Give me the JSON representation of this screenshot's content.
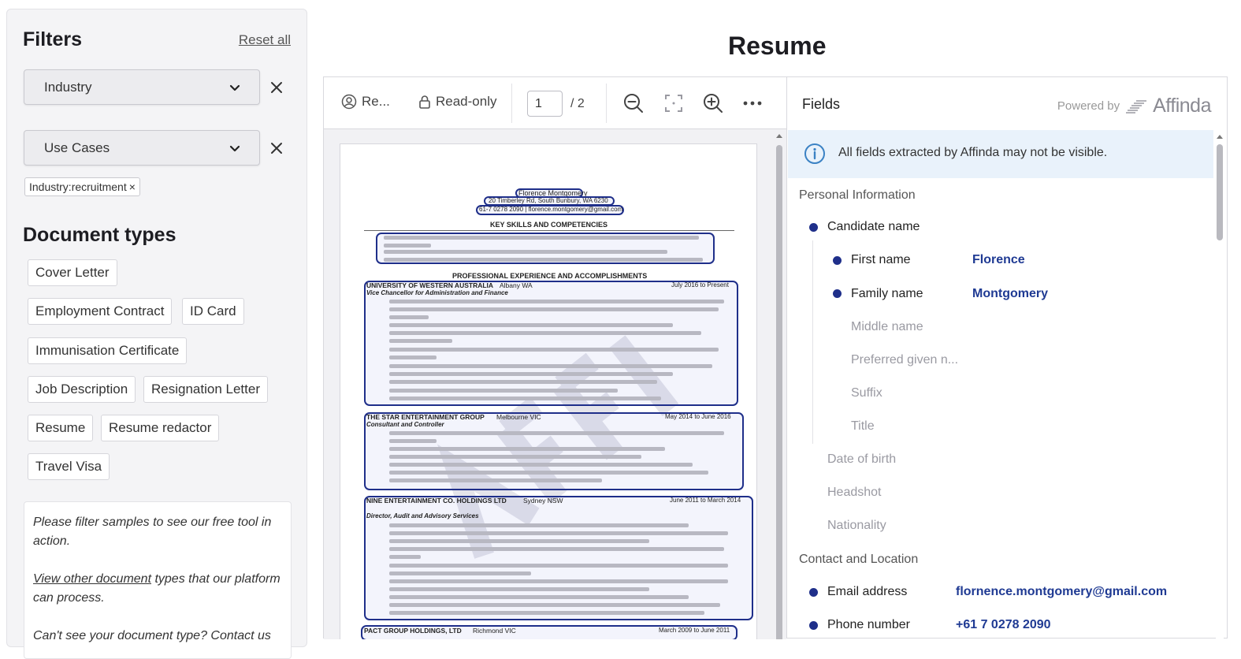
{
  "filters": {
    "title": "Filters",
    "reset_label": "Reset all",
    "selects": [
      {
        "label": "Industry"
      },
      {
        "label": "Use Cases"
      }
    ],
    "active_chip": "Industry:recruitment",
    "chip_close": "×"
  },
  "doc_types": {
    "title": "Document types",
    "items": [
      "Cover Letter",
      "Employment Contract",
      "ID Card",
      "Immunisation Certificate",
      "Job Description",
      "Resignation Letter",
      "Resume",
      "Resume redactor",
      "Travel Visa"
    ]
  },
  "info_box": {
    "line1": "Please filter samples to see our free tool in action.",
    "link": "View other document",
    "line2_rest": " types that our platform can process.",
    "line3": "Can't see your document type? Contact us"
  },
  "main": {
    "title": "Resume"
  },
  "toolbar": {
    "doc_label": "Re...",
    "readonly_label": "Read-only",
    "page_current": "1",
    "page_total": "/  2"
  },
  "resume_page": {
    "name": "Florence Montgomery",
    "address": "20 Timberley Rd, South Bunbury, WA 6230",
    "contact": "61-7 0278 2090 | florence.montgomery@gmail.com",
    "section1": "KEY SKILLS AND COMPETENCIES",
    "section2": "PROFESSIONAL EXPERIENCE AND ACCOMPLISHMENTS",
    "jobs": [
      {
        "org": "UNIVERSITY OF WESTERN AUSTRALIA",
        "loc": "Albany WA",
        "dates": "July 2016 to Present",
        "role": "Vice Chancellor for Administration and Finance"
      },
      {
        "org": "THE STAR ENTERTAINMENT GROUP",
        "loc": "Melbourne VIC",
        "dates": "May 2014 to June 2016",
        "role": "Consultant and Controller"
      },
      {
        "org": "NINE ENTERTAINMENT CO. HOLDINGS LTD",
        "loc": "Sydney NSW",
        "dates": "June 2011 to March 2014",
        "role": "Director, Audit and Advisory Services"
      },
      {
        "org": "PACT GROUP HOLDINGS, LTD",
        "loc": "Richmond VIC",
        "dates": "March 2009 to June 2011",
        "role": ""
      }
    ]
  },
  "fields": {
    "title": "Fields",
    "powered_by": "Powered by",
    "brand": "Affinda",
    "notice": "All fields extracted by Affinda may not be visible.",
    "sections": {
      "personal": "Personal Information",
      "contact": "Contact and Location"
    },
    "items": {
      "candidate_name": "Candidate name",
      "first_name": "First name",
      "first_name_val": "Florence",
      "family_name": "Family name",
      "family_name_val": "Montgomery",
      "middle_name": "Middle name",
      "preferred_given": "Preferred given n...",
      "suffix": "Suffix",
      "title": "Title",
      "dob": "Date of birth",
      "headshot": "Headshot",
      "nationality": "Nationality",
      "email": "Email address",
      "email_val": "flornence.montgomery@gmail.com",
      "phone": "Phone number",
      "phone_val": "+61 7 0278 2090"
    }
  }
}
